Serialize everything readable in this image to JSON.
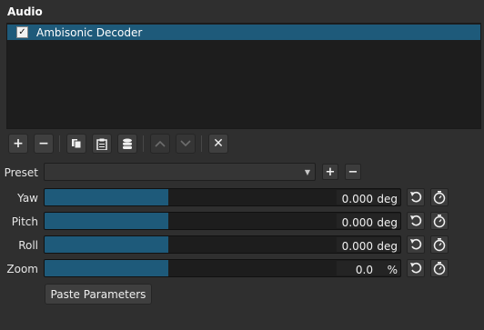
{
  "panel": {
    "title": "Audio"
  },
  "filters": [
    {
      "name": "Ambisonic Decoder",
      "enabled": true,
      "check_glyph": "✓"
    }
  ],
  "toolbar": {
    "buttons": [
      {
        "icon": "plus-icon",
        "glyph": "+"
      },
      {
        "icon": "minus-icon",
        "glyph": "−"
      },
      {
        "icon": "copy-icon"
      },
      {
        "icon": "paste-icon"
      },
      {
        "icon": "save-preset-icon"
      },
      {
        "icon": "chevron-up-icon",
        "disabled": true
      },
      {
        "icon": "chevron-down-icon",
        "disabled": true
      },
      {
        "icon": "close-icon",
        "glyph": "✕"
      }
    ]
  },
  "preset": {
    "label": "Preset",
    "value": "",
    "arrow": "▼",
    "add_glyph": "+",
    "remove_glyph": "−"
  },
  "params": [
    {
      "label": "Yaw",
      "value": "0.000",
      "unit": "deg",
      "level": 0.5
    },
    {
      "label": "Pitch",
      "value": "0.000",
      "unit": "deg",
      "level": 0.5
    },
    {
      "label": "Roll",
      "value": "0.000",
      "unit": "deg",
      "level": 0.5
    },
    {
      "label": "Zoom",
      "value": "0.0",
      "unit": "%",
      "level": 0.5
    }
  ],
  "actions": {
    "paste_parameters": "Paste Parameters"
  },
  "colors": {
    "accent": "#1e5a7a",
    "background": "#2f2f2f",
    "list_bg": "#1d1d1d"
  }
}
